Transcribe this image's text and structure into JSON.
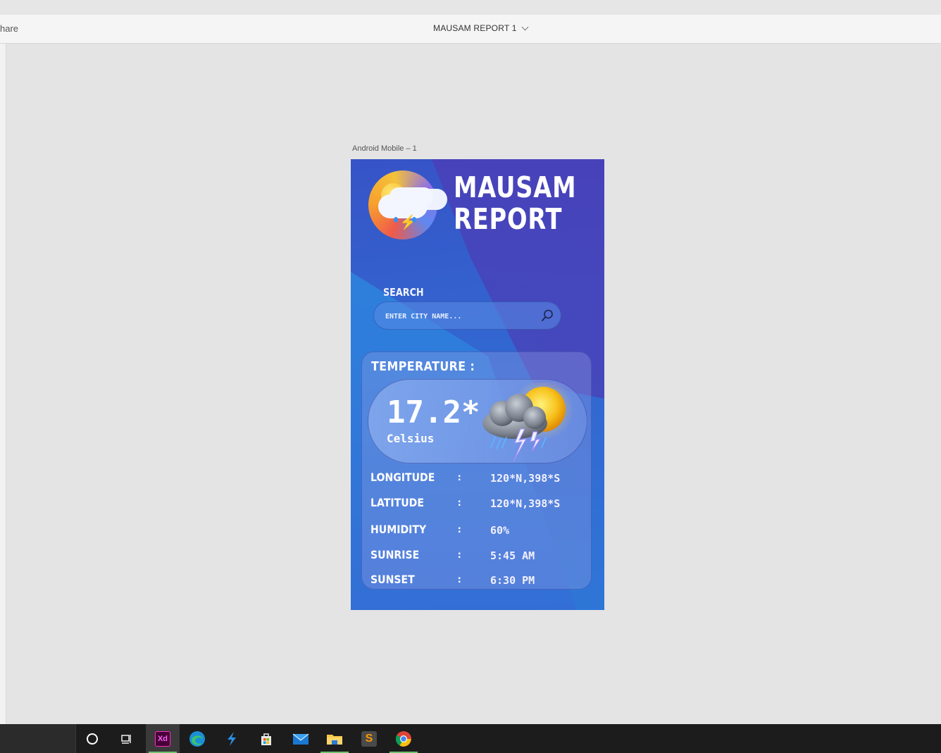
{
  "window": {
    "share_label": "hare",
    "document_title": "MAUSAM REPORT 1"
  },
  "canvas": {
    "artboard_label": "Android Mobile – 1"
  },
  "app": {
    "title_line1": "MAUSAM",
    "title_line2": "REPORT",
    "search": {
      "label": "SEARCH",
      "placeholder": "ENTER CITY NAME...",
      "value": ""
    },
    "temperature": {
      "label": "TEMPERATURE :",
      "value": "17.2*",
      "unit": "Celsius"
    },
    "details": [
      {
        "label": "LONGITUDE",
        "separator": ":",
        "value": "120*N,398*S"
      },
      {
        "label": "LATITUDE",
        "separator": ":",
        "value": "120*N,398*S"
      },
      {
        "label": "HUMIDITY",
        "separator": ":",
        "value": "60%"
      },
      {
        "label": "SUNRISE",
        "separator": ":",
        "value": "5:45 AM"
      },
      {
        "label": "SUNSET",
        "separator": ":",
        "value": "6:30 PM"
      }
    ]
  },
  "taskbar": {
    "items": [
      {
        "icon": "cortana-circle-icon"
      },
      {
        "icon": "task-view-icon"
      },
      {
        "icon": "adobe-xd-icon",
        "text": "Xd"
      },
      {
        "icon": "edge-icon"
      },
      {
        "icon": "visual-studio-icon"
      },
      {
        "icon": "store-icon"
      },
      {
        "icon": "mail-icon"
      },
      {
        "icon": "file-explorer-icon"
      },
      {
        "icon": "sublime-text-icon",
        "text": "S"
      },
      {
        "icon": "chrome-icon"
      }
    ]
  },
  "colors": {
    "artboard_primary": "#3b4bc4",
    "artboard_secondary": "#2b88e0",
    "taskbar": "#1c1c1c",
    "xd_accent": "#ff2bc2"
  }
}
